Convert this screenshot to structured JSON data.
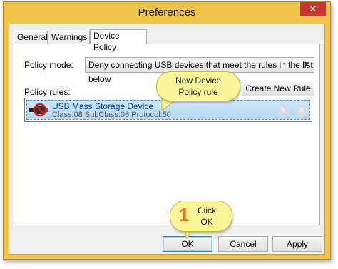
{
  "window": {
    "title": "Preferences",
    "close_glyph": "✕"
  },
  "tabs": [
    {
      "label": "General"
    },
    {
      "label": "Warnings"
    },
    {
      "label": "Device Policy"
    }
  ],
  "policy": {
    "mode_label": "Policy mode:",
    "mode_value": "Deny connecting USB devices that meet the rules in the list below",
    "rules_label": "Policy rules:",
    "create_rule_label": "Create New Rule"
  },
  "rules": [
    {
      "name": "USB Mass Storage Device",
      "details": "Class:08  SubClass:06  Protocol:50",
      "icon": "usb-blocked-icon"
    }
  ],
  "callouts": {
    "new_rule_line1": "New Device",
    "new_rule_line2": "Policy rule",
    "step_number": "1",
    "click_line1": "Click",
    "click_line2": "OK"
  },
  "footer": {
    "ok_label": "OK",
    "cancel_label": "Cancel",
    "apply_label": "Apply"
  },
  "colors": {
    "window_frame": "#f0c34a",
    "close_button": "#c7372f",
    "selection": "#b5d7ef",
    "callout": "#fdf59a",
    "step_number": "#e8731a"
  }
}
